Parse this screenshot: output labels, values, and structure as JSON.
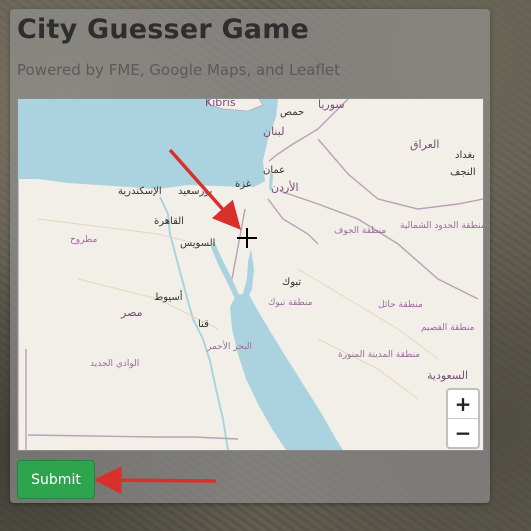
{
  "header": {
    "title": "City Guesser Game",
    "subtitle": "Powered by FME, Google Maps, and Leaflet"
  },
  "map": {
    "labels": {
      "kibris": "Kıbrıs",
      "syria": "سوريا",
      "homs": "حمص",
      "lebanon": "لبنان",
      "alexandria": "الإسكندرية",
      "port_said": "بورسعيد",
      "gaza": "غزة",
      "amman": "عمان",
      "jordan": "الأردن",
      "iraq": "العراق",
      "baghdad": "بغداد",
      "najaf": "النجف",
      "matruh": "مطروح",
      "cairo": "القاهرة",
      "suez": "السويس",
      "jawf_region": "منطقة الجوف",
      "northern_border_region": "منطقة الحدود الشمالية",
      "tabuk": "تبوك",
      "tabuk_region": "منطقة تبوك",
      "assiut": "أسيوط",
      "egypt": "مصر",
      "hail_region": "منطقة حائل",
      "qena": "قنا",
      "qassim_region": "منطقة القصيم",
      "red_sea": "البحر الأحمر",
      "new_valley": "الوادي الجديد",
      "madinah_region": "منطقة المدينة المنورة",
      "saudi": "السعودية"
    },
    "zoom_in": "+",
    "zoom_out": "−"
  },
  "actions": {
    "submit_label": "Submit"
  },
  "colors": {
    "submit_bg": "#2ea44f",
    "arrow": "#d9302c",
    "water": "#aad3df",
    "land": "#f2efe9"
  }
}
